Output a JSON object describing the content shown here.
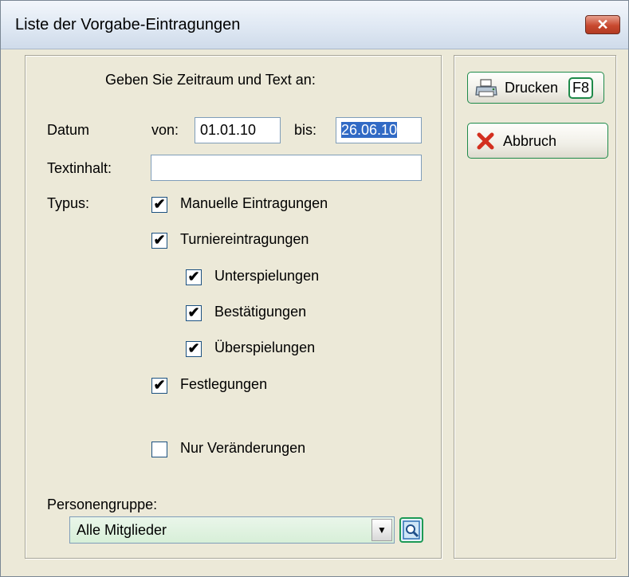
{
  "window": {
    "title": "Liste der Vorgabe-Eintragungen"
  },
  "form": {
    "heading": "Geben Sie Zeitraum und Text an:",
    "datum_label": "Datum",
    "von_label": "von:",
    "von_value": "01.01.10",
    "bis_label": "bis:",
    "bis_value": "26.06.10",
    "textinhalt_label": "Textinhalt:",
    "textinhalt_value": "",
    "typus_label": "Typus:",
    "checkboxes": [
      {
        "label": "Manuelle Eintragungen",
        "checked": true
      },
      {
        "label": "Turniereintragungen",
        "checked": true
      },
      {
        "label": "Unterspielungen",
        "checked": true
      },
      {
        "label": "Bestätigungen",
        "checked": true
      },
      {
        "label": "Überspielungen",
        "checked": true
      },
      {
        "label": "Festlegungen",
        "checked": true
      },
      {
        "label": "Nur Veränderungen",
        "checked": false
      }
    ],
    "check_mark": "✔",
    "personengruppe_label": "Personengruppe:",
    "personengruppe_value": "Alle Mitglieder",
    "dropdown_arrow": "▼"
  },
  "buttons": {
    "drucken_label": "Drucken",
    "drucken_key": "F8",
    "abbruch_label": "Abbruch",
    "close_glyph": "✕"
  },
  "icons": {
    "printer": "printer-icon",
    "cancel": "cancel-x-icon",
    "search": "magnifier-icon",
    "close": "close-icon"
  },
  "colors": {
    "dialog_bg": "#ece9d8",
    "button_border": "#1f8a4a",
    "selection": "#316ac5",
    "close_red": "#c8492f"
  }
}
